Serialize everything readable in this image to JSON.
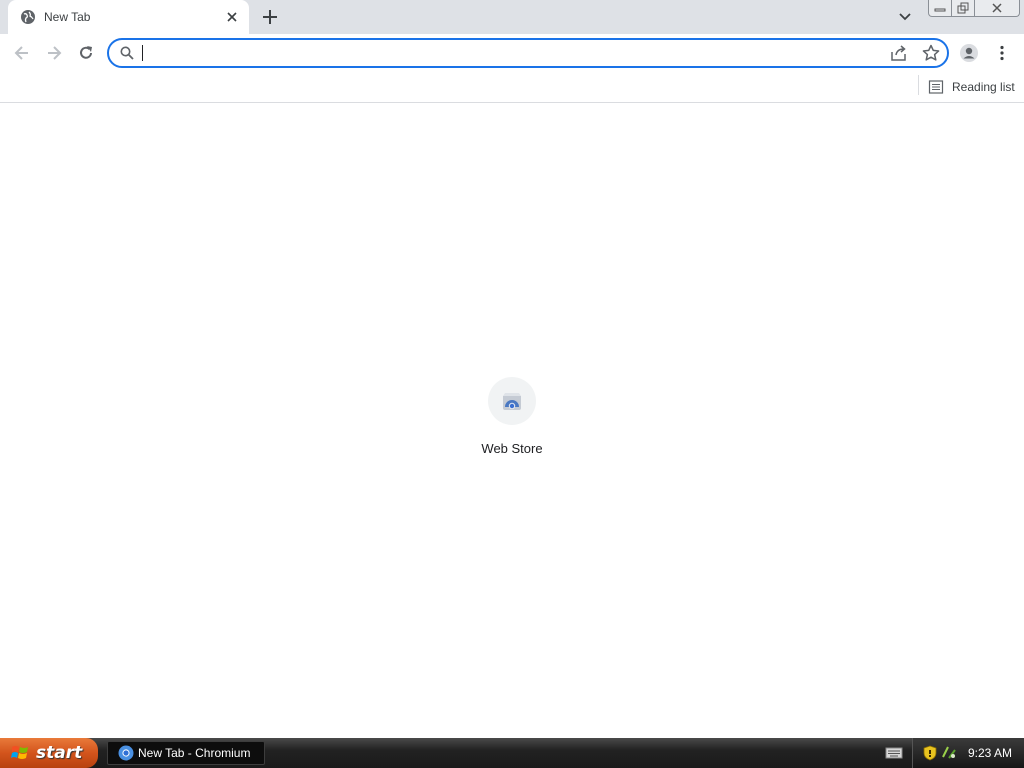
{
  "browser": {
    "tabs": [
      {
        "title": "New Tab"
      }
    ],
    "omnibox": {
      "value": "",
      "placeholder": ""
    },
    "bookmarks_bar": {
      "reading_list_label": "Reading list"
    }
  },
  "new_tab_page": {
    "shortcuts": [
      {
        "title": "Web Store",
        "icon": "web-store-icon"
      }
    ]
  },
  "taskbar": {
    "start_label": "start",
    "items": [
      {
        "label": "New Tab - Chromium"
      }
    ],
    "clock": "9:23 AM"
  },
  "colors": {
    "accent": "#1a73e8",
    "tabstrip": "#dee1e6",
    "start_button": "#d3541c"
  }
}
